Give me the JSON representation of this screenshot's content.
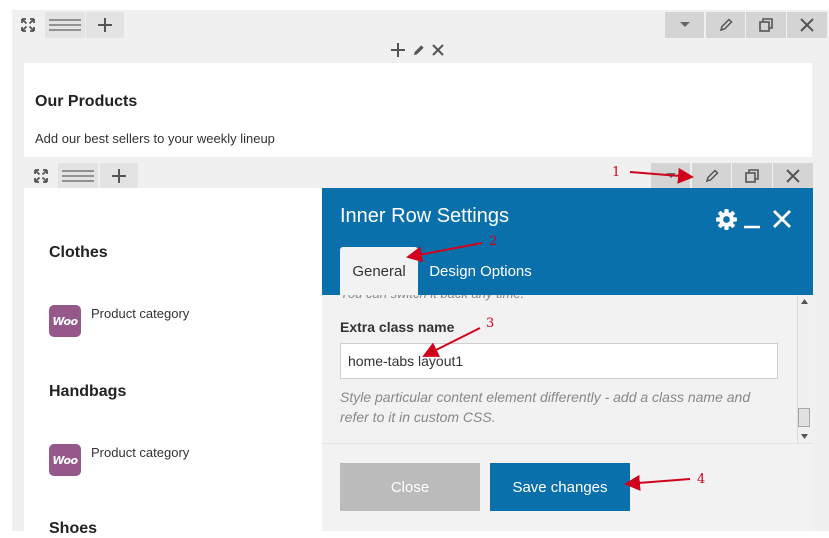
{
  "outer_row": {
    "toolbar_icons": [
      "move-icon",
      "drag-handle-icon",
      "add-icon"
    ],
    "right_icons": [
      "dropdown-icon",
      "edit-icon",
      "clone-icon",
      "close-icon"
    ]
  },
  "element_controls": [
    "add-icon",
    "edit-icon",
    "close-icon"
  ],
  "text_block": {
    "heading": "Our Products",
    "description": "Add our best sellers to your weekly lineup"
  },
  "inner_row": {
    "categories": [
      {
        "title": "Clothes",
        "badge": "Woo",
        "label": "Product category"
      },
      {
        "title": "Handbags",
        "badge": "Woo",
        "label": "Product category"
      },
      {
        "title": "Shoes"
      }
    ]
  },
  "modal": {
    "title": "Inner Row Settings",
    "tabs": [
      "General",
      "Design Options"
    ],
    "active_tab": "General",
    "partial_text": "You can switch it back any time.",
    "field_label": "Extra class name",
    "field_value": "home-tabs layout1",
    "help_text_line1": "Style particular content element differently - add a class name and",
    "help_text_line2": "refer to it in custom CSS.",
    "close_label": "Close",
    "save_label": "Save changes"
  },
  "annotations": [
    "1",
    "2",
    "3",
    "4"
  ],
  "colors": {
    "modal_header": "#0a70ac",
    "save_button": "#0a70ac",
    "close_button": "#bbbbbb",
    "woo_badge": "#96588a",
    "annotation": "#d0021b",
    "toolbar_gray": "#e3e3e3"
  }
}
